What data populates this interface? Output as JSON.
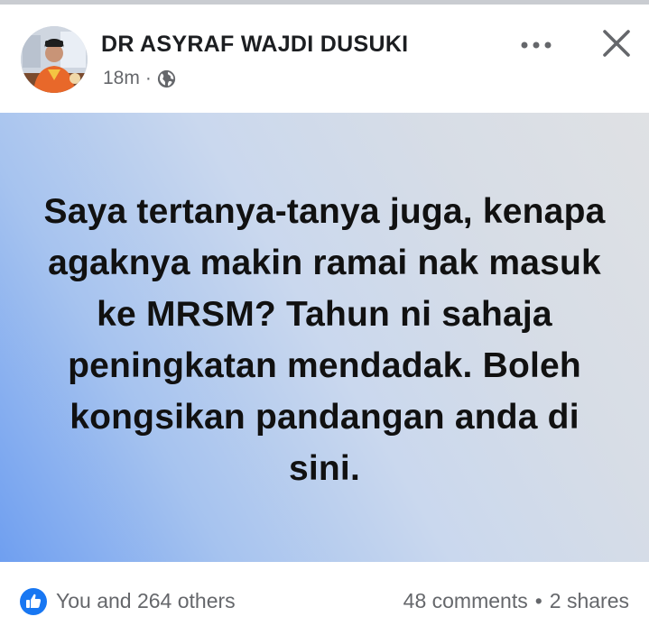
{
  "post": {
    "author": "DR ASYRAF WAJDI DUSUKI",
    "time": "18m",
    "separator": "·",
    "privacy_icon": "globe-icon",
    "text": "Saya tertanya-tanya juga, kenapa agaknya makin ramai nak masuk ke MRSM? Tahun ni sahaja peningkatan mendadak. Boleh kongsikan pandangan anda di sini.",
    "background_colors": [
      "#6f9ff0",
      "#cad8ee",
      "#dfe1e4"
    ]
  },
  "header_actions": {
    "more_icon": "more-horizontal-icon",
    "close_icon": "close-icon"
  },
  "footer": {
    "reaction_icon": "like-icon",
    "reaction_color": "#1877f2",
    "reactions_text": "You and 264 others",
    "comments": "48 comments",
    "dot": "•",
    "shares": "2 shares"
  }
}
